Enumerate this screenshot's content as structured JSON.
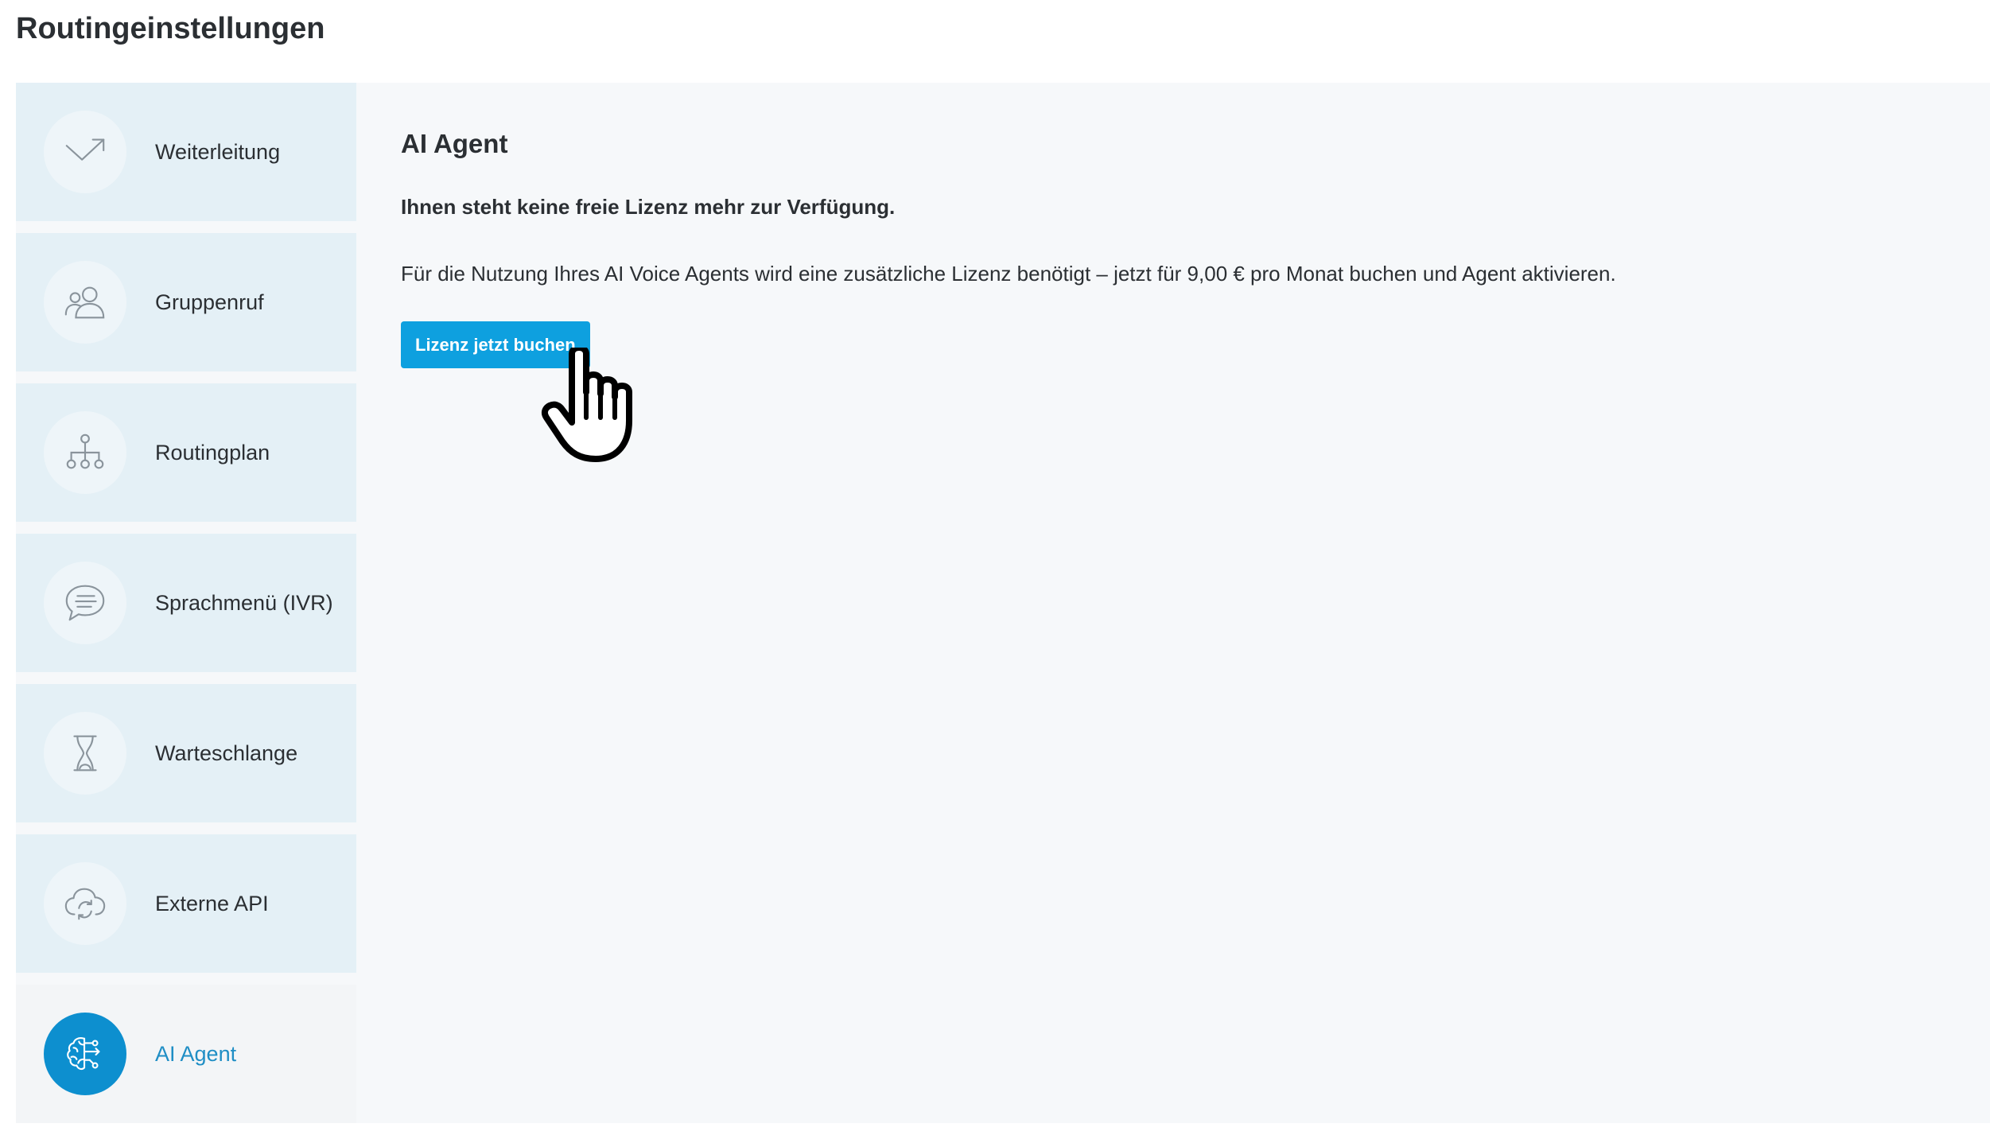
{
  "page": {
    "title": "Routingeinstellungen"
  },
  "sidebar": {
    "items": [
      {
        "label": "Weiterleitung",
        "icon": "forward-arrow-icon",
        "active": false
      },
      {
        "label": "Gruppenruf",
        "icon": "group-icon",
        "active": false
      },
      {
        "label": "Routingplan",
        "icon": "hierarchy-icon",
        "active": false
      },
      {
        "label": "Sprachmenü (IVR)",
        "icon": "speech-bubble-icon",
        "active": false
      },
      {
        "label": "Warteschlange",
        "icon": "hourglass-icon",
        "active": false
      },
      {
        "label": "Externe API",
        "icon": "cloud-sync-icon",
        "active": false
      },
      {
        "label": "AI Agent",
        "icon": "ai-brain-icon",
        "active": true
      }
    ]
  },
  "content": {
    "title": "AI Agent",
    "notice": "Ihnen steht keine freie Lizenz mehr zur Verfügung.",
    "description": "Für die Nutzung Ihres AI Voice Agents wird eine zusätzliche Lizenz benötigt – jetzt für 9,00 € pro Monat buchen und Agent aktivieren.",
    "button_label": "Lizenz jetzt buchen"
  },
  "colors": {
    "accent": "#0ea0df",
    "active_circle": "#0d8fcf",
    "active_label": "#1f8ec5",
    "nav_bg": "#e4f0f6",
    "panel_bg": "#f6f8fa"
  }
}
